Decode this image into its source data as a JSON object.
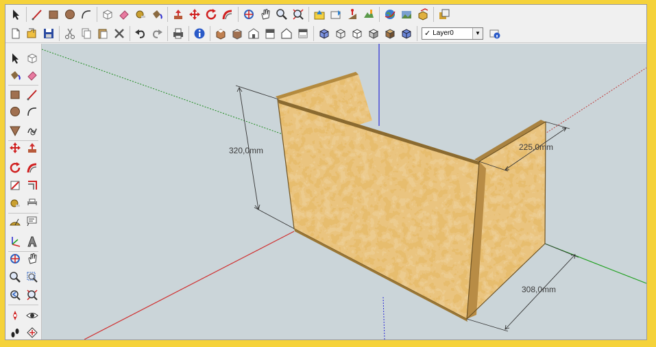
{
  "toolbar": {
    "row1_icons": [
      "select-icon",
      "line-icon",
      "rectangle-icon",
      "circle-icon",
      "arc-icon",
      "make-component-icon",
      "eraser-icon",
      "tape-measure-icon",
      "paint-bucket-icon",
      "push-pull-icon",
      "move-icon",
      "rotate-icon",
      "follow-me-icon",
      "orbit-icon",
      "pan-icon",
      "zoom-icon",
      "zoom-extents-icon",
      "get-models-icon",
      "share-model-icon",
      "add-location-icon",
      "toggle-terrain-icon",
      "preview-google-earth-icon",
      "get-photo-texture-icon",
      "components-icon",
      "styles-icon"
    ],
    "row2_icons": [
      "new-icon",
      "open-icon",
      "save-icon",
      "cut-icon",
      "copy-icon",
      "paste-icon",
      "delete-icon",
      "undo-icon",
      "redo-icon",
      "print-icon",
      "model-info-icon",
      "iso-view-icon",
      "top-view-icon",
      "front-view-icon",
      "right-view-icon",
      "back-view-icon",
      "left-view-icon",
      "xray-icon",
      "wireframe-icon",
      "hidden-line-icon",
      "shaded-icon",
      "shaded-texture-icon",
      "monochrome-icon",
      "layer-manager-icon"
    ]
  },
  "layer": {
    "current": "Layer0",
    "check": "✓",
    "arrow": "▼"
  },
  "left_toolbar_icons": [
    "select-icon",
    "make-component-icon",
    "paint-bucket-icon",
    "eraser-icon",
    "rectangle-icon",
    "line-icon",
    "circle-icon",
    "arc-icon",
    "polygon-icon",
    "freehand-icon",
    "move-icon",
    "push-pull-icon",
    "rotate-icon",
    "follow-me-icon",
    "scale-icon",
    "offset-icon",
    "tape-measure-icon",
    "dimension-icon",
    "protractor-icon",
    "text-icon",
    "axes-icon",
    "3d-text-icon",
    "orbit-icon",
    "pan-icon",
    "zoom-icon",
    "zoom-window-icon",
    "previous-view-icon",
    "zoom-extents-icon",
    "position-camera-icon",
    "look-around-icon",
    "walk-icon",
    "section-plane-icon"
  ],
  "dimensions": {
    "height": "320,0mm",
    "depth_top": "225,0mm",
    "depth_bottom": "308,0mm"
  },
  "colors": {
    "sky": "#cbd5d9",
    "board": "#d3a34e",
    "board_edge": "#8a6a30",
    "axis_red": "#d03030",
    "axis_green": "#20a020",
    "axis_blue": "#3030d0",
    "frame": "#f5d23a"
  }
}
